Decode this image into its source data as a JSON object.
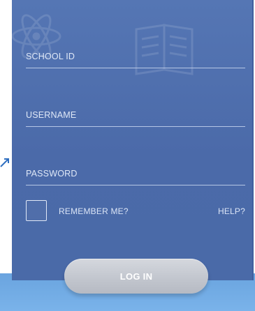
{
  "form": {
    "fields": [
      {
        "label": "SCHOOL ID"
      },
      {
        "label": "USERNAME"
      },
      {
        "label": "PASSWORD"
      }
    ],
    "remember_label": "REMEMBER ME?",
    "help_label": "HELP?",
    "login_label": "LOG IN"
  },
  "colors": {
    "panel": "#4b6aa9",
    "button": "#c1c5cd",
    "accent_strip": "#6aa4df"
  },
  "icons": {
    "background_doodles": [
      "atom-icon",
      "book-icon"
    ],
    "side_arrow": "arrow-icon"
  }
}
